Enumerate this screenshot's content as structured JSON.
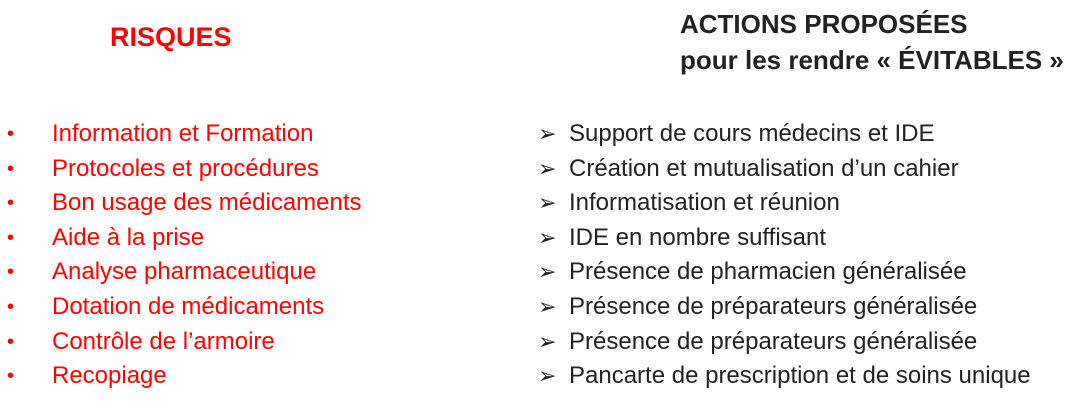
{
  "risques": {
    "title": "RISQUES",
    "bullet": "•",
    "items": [
      {
        "label": "Information et Formation"
      },
      {
        "label": "Protocoles et procédures"
      },
      {
        "label": "Bon usage des médicaments"
      },
      {
        "label": "Aide à la prise"
      },
      {
        "label": "Analyse pharmaceutique"
      },
      {
        "label": "Dotation de médicaments"
      },
      {
        "label": "Contrôle de l’armoire"
      },
      {
        "label": "Recopiage"
      }
    ]
  },
  "actions": {
    "title_line1": "ACTIONS PROPOSÉES",
    "title_line2": "pour les rendre « ÉVITABLES »",
    "arrow": "➢",
    "items": [
      {
        "label": "Support de cours médecins et IDE"
      },
      {
        "label": "Création et mutualisation d’un cahier"
      },
      {
        "label": "Informatisation et réunion"
      },
      {
        "label": "IDE en nombre suffisant"
      },
      {
        "label": "Présence de pharmacien généralisée"
      },
      {
        "label": "Présence de préparateurs généralisée"
      },
      {
        "label": "Présence de préparateurs généralisée"
      },
      {
        "label": "Pancarte de prescription et de soins unique"
      }
    ]
  },
  "colors": {
    "risk_text": "#ff0000",
    "action_text": "#222222",
    "background": "#ffffff"
  }
}
